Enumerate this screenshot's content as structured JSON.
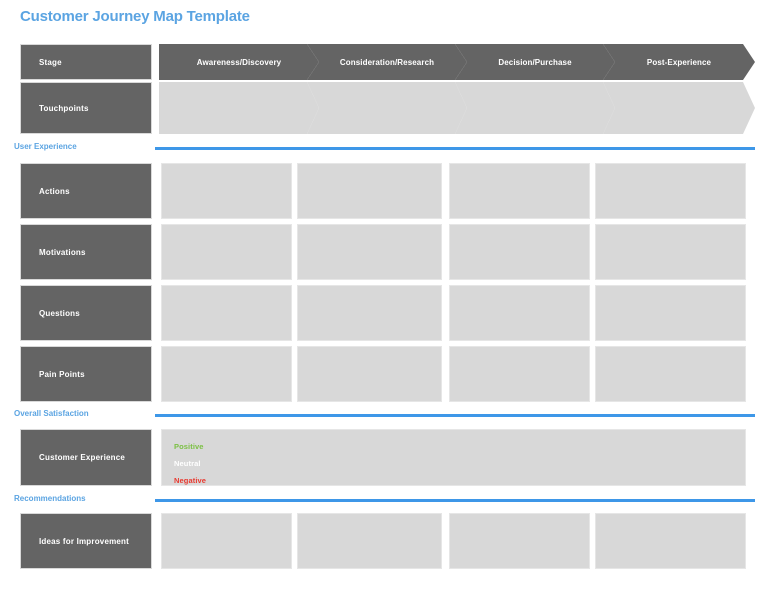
{
  "page": {
    "title": "Customer Journey Map Template",
    "accent_blue": "#5BA4E2",
    "rule_blue": "#3E97E8",
    "dark_gray": "#646464",
    "light_gray": "#d8d8d8"
  },
  "stages": [
    {
      "label": "Awareness/Discovery"
    },
    {
      "label": "Consideration/Research"
    },
    {
      "label": "Decision/Purchase"
    },
    {
      "label": "Post-Experience"
    }
  ],
  "header_rows": [
    {
      "label": "Stage",
      "type": "chevron-dark"
    },
    {
      "label": "Touchpoints",
      "type": "chevron-light"
    }
  ],
  "sections": [
    {
      "heading": "User Experience",
      "rows": [
        {
          "label": "Actions"
        },
        {
          "label": "Motivations"
        },
        {
          "label": "Questions"
        },
        {
          "label": "Pain Points"
        }
      ]
    },
    {
      "heading": "Overall Satisfaction",
      "rows": [
        {
          "label": "Customer Experience"
        }
      ]
    },
    {
      "heading": "Recommendations",
      "rows": [
        {
          "label": "Ideas for Improvement"
        }
      ]
    }
  ],
  "satisfaction_legend": [
    {
      "label": "Positive",
      "color": "#7BC043"
    },
    {
      "label": "Neutral",
      "color": "#FFFFFF"
    },
    {
      "label": "Negative",
      "color": "#E8392F"
    }
  ]
}
